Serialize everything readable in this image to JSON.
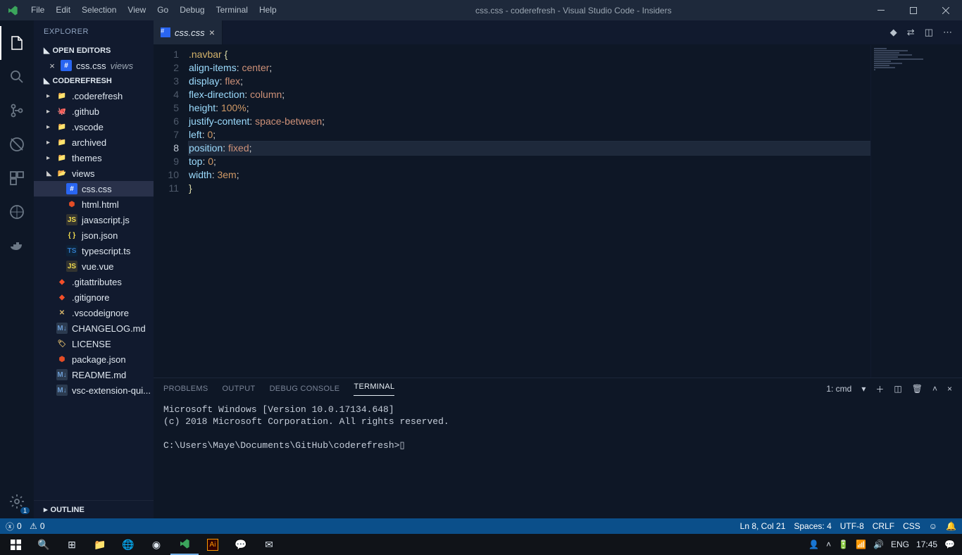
{
  "titlebar": {
    "menus": [
      "File",
      "Edit",
      "Selection",
      "View",
      "Go",
      "Debug",
      "Terminal",
      "Help"
    ],
    "title": "css.css - coderefresh - Visual Studio Code - Insiders"
  },
  "activity": {
    "items": [
      "explorer",
      "search",
      "scm",
      "debug",
      "extensions",
      "remote",
      "docker"
    ],
    "bottom": [
      "settings"
    ],
    "settings_badge": "1"
  },
  "sidebar": {
    "panel": "EXPLORER",
    "section_open": "OPEN EDITORS",
    "open_editors": [
      {
        "name": "css.css",
        "hint": "views"
      }
    ],
    "workspace": "CODEREFRESH",
    "tree": [
      {
        "kind": "folder",
        "name": ".coderefresh",
        "depth": 1,
        "icon": "folder"
      },
      {
        "kind": "folder",
        "name": ".github",
        "depth": 1,
        "icon": "github"
      },
      {
        "kind": "folder",
        "name": ".vscode",
        "depth": 1,
        "icon": "folder"
      },
      {
        "kind": "folder",
        "name": "archived",
        "depth": 1,
        "icon": "folder"
      },
      {
        "kind": "folder",
        "name": "themes",
        "depth": 1,
        "icon": "folder"
      },
      {
        "kind": "folder-open",
        "name": "views",
        "depth": 1,
        "icon": "folder-open"
      },
      {
        "kind": "file",
        "name": "css.css",
        "depth": 2,
        "icon": "css",
        "selected": true
      },
      {
        "kind": "file",
        "name": "html.html",
        "depth": 2,
        "icon": "html"
      },
      {
        "kind": "file",
        "name": "javascript.js",
        "depth": 2,
        "icon": "js"
      },
      {
        "kind": "file",
        "name": "json.json",
        "depth": 2,
        "icon": "json"
      },
      {
        "kind": "file",
        "name": "typescript.ts",
        "depth": 2,
        "icon": "ts"
      },
      {
        "kind": "file",
        "name": "vue.vue",
        "depth": 2,
        "icon": "js"
      },
      {
        "kind": "file",
        "name": ".gitattributes",
        "depth": 1,
        "icon": "git"
      },
      {
        "kind": "file",
        "name": ".gitignore",
        "depth": 1,
        "icon": "git"
      },
      {
        "kind": "file",
        "name": ".vscodeignore",
        "depth": 1,
        "icon": "vscodeignore"
      },
      {
        "kind": "file",
        "name": "CHANGELOG.md",
        "depth": 1,
        "icon": "md"
      },
      {
        "kind": "file",
        "name": "LICENSE",
        "depth": 1,
        "icon": "license"
      },
      {
        "kind": "file",
        "name": "package.json",
        "depth": 1,
        "icon": "npm"
      },
      {
        "kind": "file",
        "name": "README.md",
        "depth": 1,
        "icon": "md"
      },
      {
        "kind": "file",
        "name": "vsc-extension-qui...",
        "depth": 1,
        "icon": "md"
      }
    ],
    "outline": "OUTLINE"
  },
  "tabs": {
    "open": [
      {
        "name": "css.css"
      }
    ]
  },
  "editor": {
    "lines": [
      [
        {
          "t": ".navbar",
          "c": "sel"
        },
        {
          "t": " "
        },
        {
          "t": "{",
          "c": "brace"
        }
      ],
      [
        {
          "t": "    "
        },
        {
          "t": "align-items",
          "c": "prop"
        },
        {
          "t": ": ",
          "c": "punc"
        },
        {
          "t": "center",
          "c": "val"
        },
        {
          "t": ";",
          "c": "punc"
        }
      ],
      [
        {
          "t": "    "
        },
        {
          "t": "display",
          "c": "prop"
        },
        {
          "t": ": ",
          "c": "punc"
        },
        {
          "t": "flex",
          "c": "val"
        },
        {
          "t": ";",
          "c": "punc"
        }
      ],
      [
        {
          "t": "    "
        },
        {
          "t": "flex-direction",
          "c": "prop"
        },
        {
          "t": ": ",
          "c": "punc"
        },
        {
          "t": "column",
          "c": "val"
        },
        {
          "t": ";",
          "c": "punc"
        }
      ],
      [
        {
          "t": "    "
        },
        {
          "t": "height",
          "c": "prop"
        },
        {
          "t": ": ",
          "c": "punc"
        },
        {
          "t": "100%",
          "c": "num"
        },
        {
          "t": ";",
          "c": "punc"
        }
      ],
      [
        {
          "t": "    "
        },
        {
          "t": "justify-content",
          "c": "prop"
        },
        {
          "t": ": ",
          "c": "punc"
        },
        {
          "t": "space-between",
          "c": "val"
        },
        {
          "t": ";",
          "c": "punc"
        }
      ],
      [
        {
          "t": "    "
        },
        {
          "t": "left",
          "c": "prop"
        },
        {
          "t": ": ",
          "c": "punc"
        },
        {
          "t": "0",
          "c": "num"
        },
        {
          "t": ";",
          "c": "punc"
        }
      ],
      [
        {
          "t": "    "
        },
        {
          "t": "position",
          "c": "prop"
        },
        {
          "t": ": ",
          "c": "punc"
        },
        {
          "t": "fixed",
          "c": "val"
        },
        {
          "t": ";",
          "c": "punc"
        }
      ],
      [
        {
          "t": "    "
        },
        {
          "t": "top",
          "c": "prop"
        },
        {
          "t": ": ",
          "c": "punc"
        },
        {
          "t": "0",
          "c": "num"
        },
        {
          "t": ";",
          "c": "punc"
        }
      ],
      [
        {
          "t": "    "
        },
        {
          "t": "width",
          "c": "prop"
        },
        {
          "t": ": ",
          "c": "punc"
        },
        {
          "t": "3em",
          "c": "num"
        },
        {
          "t": ";",
          "c": "punc"
        }
      ],
      [
        {
          "t": "}",
          "c": "brace"
        }
      ]
    ],
    "current_line": 8
  },
  "panel": {
    "tabs": [
      "PROBLEMS",
      "OUTPUT",
      "DEBUG CONSOLE",
      "TERMINAL"
    ],
    "active_tab": "TERMINAL",
    "selector": "1: cmd",
    "body": "Microsoft Windows [Version 10.0.17134.648]\n(c) 2018 Microsoft Corporation. All rights reserved.\n\nC:\\Users\\Maye\\Documents\\GitHub\\coderefresh>▯"
  },
  "statusbar": {
    "left": {
      "errors": "0",
      "sync": "0",
      "warnings": "0"
    },
    "right": {
      "ln": "Ln 8, Col 21",
      "spaces": "Spaces: 4",
      "encoding": "UTF-8",
      "eol": "CRLF",
      "lang": "CSS"
    }
  },
  "taskbar": {
    "time": "17:45",
    "lang": "ENG"
  }
}
